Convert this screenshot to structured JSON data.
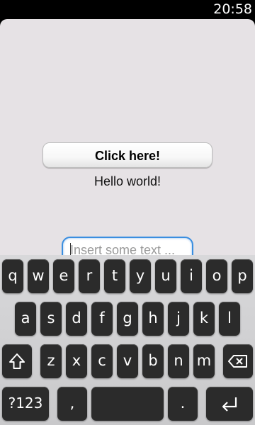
{
  "status_bar": {
    "time": "20:58"
  },
  "app": {
    "button_label": "Click here!",
    "output_text": "Hello world!",
    "input": {
      "value": "",
      "placeholder": "Insert some text ..."
    }
  },
  "keyboard": {
    "row1": [
      "q",
      "w",
      "e",
      "r",
      "t",
      "y",
      "u",
      "i",
      "o",
      "p"
    ],
    "row2": [
      "a",
      "s",
      "d",
      "f",
      "g",
      "h",
      "j",
      "k",
      "l"
    ],
    "row3": [
      "z",
      "x",
      "c",
      "v",
      "b",
      "n",
      "m"
    ],
    "row4": {
      "symbols": "?123",
      "comma": ",",
      "space": "",
      "period": "."
    },
    "icons": {
      "shift": "shift-icon",
      "backspace": "backspace-icon",
      "enter": "enter-icon"
    }
  }
}
